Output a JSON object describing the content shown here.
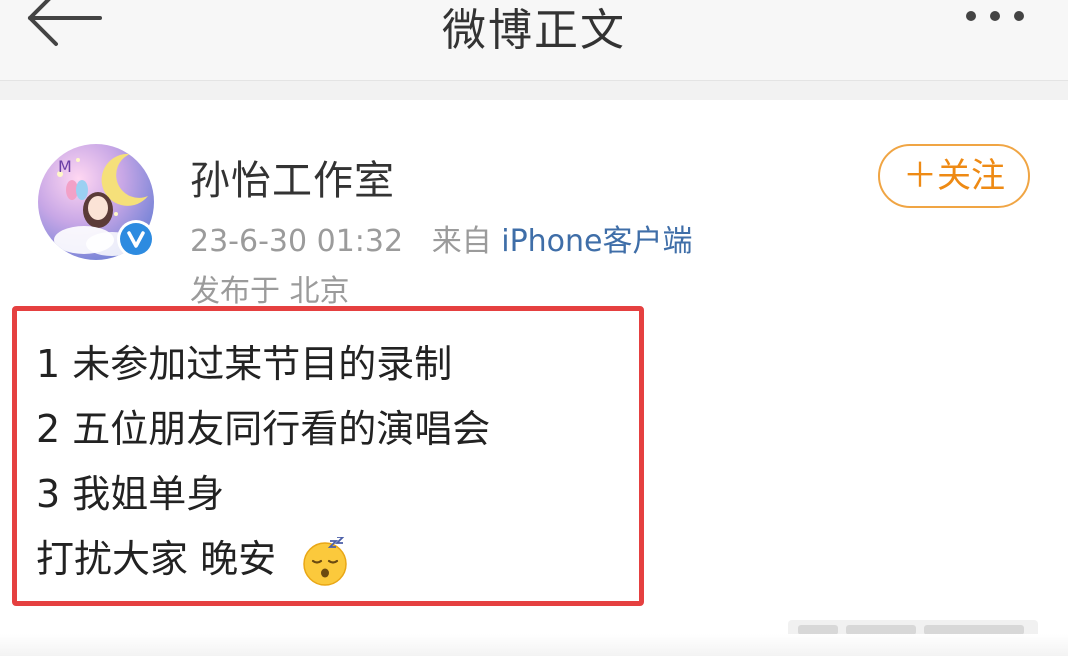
{
  "header": {
    "title": "微博正文",
    "back_icon": "arrow-left-icon",
    "more_icon": "more-horizontal-icon"
  },
  "post": {
    "author": "孙怡工作室",
    "timestamp": "23-6-30 01:32",
    "source_prefix": "来自",
    "source_name": "iPhone客户端",
    "location": "发布于 北京",
    "follow_label": "＋关注",
    "lines": [
      "1 未参加过某节目的录制",
      "2 五位朋友同行看的演唱会",
      "3 我姐单身",
      "打扰大家 晚安"
    ],
    "emoji": "sleeping-face-emoji",
    "verified_icon": "verified-badge-icon"
  },
  "colors": {
    "accent_orange": "#ee8a14",
    "link_blue": "#3f6ea8",
    "highlight_red": "#e54040",
    "verified_blue": "#2d8be0"
  }
}
